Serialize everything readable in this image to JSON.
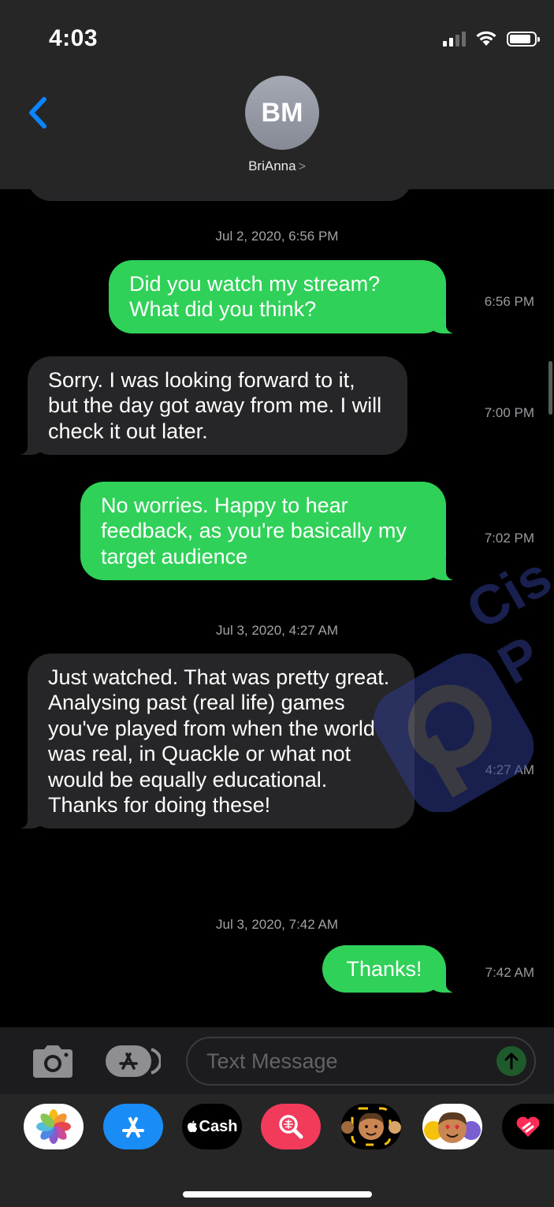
{
  "status_bar": {
    "time": "4:03"
  },
  "header": {
    "avatar_initials": "BM",
    "contact_name": "BriAnna",
    "contact_chevron": ">"
  },
  "conversation": {
    "groups": [
      {
        "date_label": "Jul 2, 2020,",
        "time_label": "6:56 PM",
        "messages": [
          {
            "direction": "outgoing",
            "text": "Did you watch my stream? What did you think?",
            "time": "6:56 PM"
          },
          {
            "direction": "incoming",
            "text": "Sorry. I was looking forward to it, but the day got away from me. I will check it out later.",
            "time": "7:00 PM"
          },
          {
            "direction": "outgoing",
            "text": "No worries. Happy to hear feedback, as you're basically my target audience",
            "time": "7:02 PM"
          }
        ]
      },
      {
        "date_label": "Jul 3, 2020,",
        "time_label": "4:27 AM",
        "messages": [
          {
            "direction": "incoming",
            "text": "Just watched. That was pretty great. Analysing past (real life) games you've played from when the world was real, in Quackle or what not would be equally educational. Thanks for doing these!",
            "time": "4:27 AM"
          }
        ]
      },
      {
        "date_label": "Jul 3, 2020,",
        "time_label": "7:42 AM",
        "messages": [
          {
            "direction": "outgoing",
            "text": "Thanks!",
            "time": "7:42 AM"
          }
        ]
      }
    ]
  },
  "input_bar": {
    "placeholder": "Text Message"
  },
  "app_drawer": {
    "apps": [
      {
        "name": "photos-app-icon"
      },
      {
        "name": "app-store-icon"
      },
      {
        "name": "apple-cash",
        "label": "Cash"
      },
      {
        "name": "image-search-icon"
      },
      {
        "name": "memoji-stickers-icon"
      },
      {
        "name": "animoji-icon"
      },
      {
        "name": "heart-stickers-icon"
      }
    ]
  },
  "colors": {
    "outgoing_bubble": "#30d158",
    "incoming_bubble": "#262628",
    "accent_blue": "#0a84ff"
  }
}
